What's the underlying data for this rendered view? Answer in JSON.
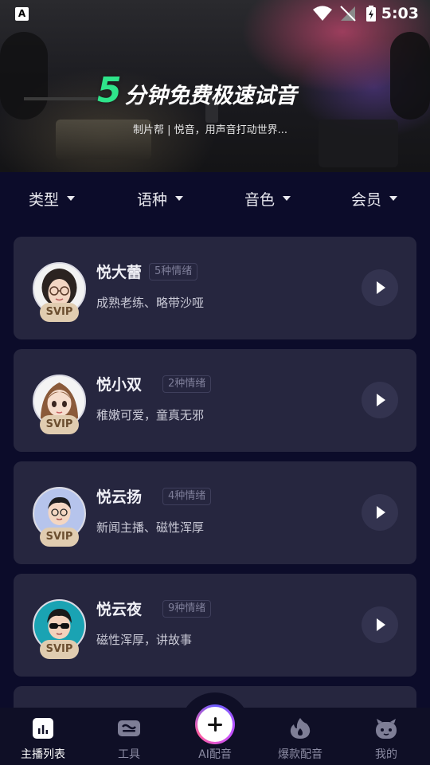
{
  "status_bar": {
    "app_badge": "A",
    "time": "5:03"
  },
  "banner": {
    "highlight": "5",
    "title": "分钟免费极速试音",
    "subtitle": "制片帮 | 悦音，用声音打动世界..."
  },
  "filters": [
    {
      "label": "类型"
    },
    {
      "label": "语种"
    },
    {
      "label": "音色"
    },
    {
      "label": "会员"
    }
  ],
  "voices": [
    {
      "name": "悦大蕾",
      "tag": "5种情绪",
      "desc": "成熟老练、略带沙哑",
      "badge": "SVIP"
    },
    {
      "name": "悦小双",
      "tag": "2种情绪",
      "desc": "稚嫩可爱，童真无邪",
      "badge": "SVIP"
    },
    {
      "name": "悦云扬",
      "tag": "4种情绪",
      "desc": "新闻主播、磁性浑厚",
      "badge": "SVIP"
    },
    {
      "name": "悦云夜",
      "tag": "9种情绪",
      "desc": "磁性浑厚，讲故事",
      "badge": "SVIP"
    }
  ],
  "bottom_nav": [
    {
      "label": "主播列表",
      "icon": "bar-chart-icon",
      "active": true
    },
    {
      "label": "工具",
      "icon": "tools-icon",
      "active": false
    },
    {
      "label": "AI配音",
      "icon": "plus-icon",
      "active": false
    },
    {
      "label": "爆款配音",
      "icon": "fire-icon",
      "active": false
    },
    {
      "label": "我的",
      "icon": "robot-icon",
      "active": false
    }
  ],
  "colors": {
    "background": "#0c0c2a",
    "card": "#26263f",
    "accent_green": "#2fe38a",
    "svip_badge": "#e0ccb0"
  }
}
